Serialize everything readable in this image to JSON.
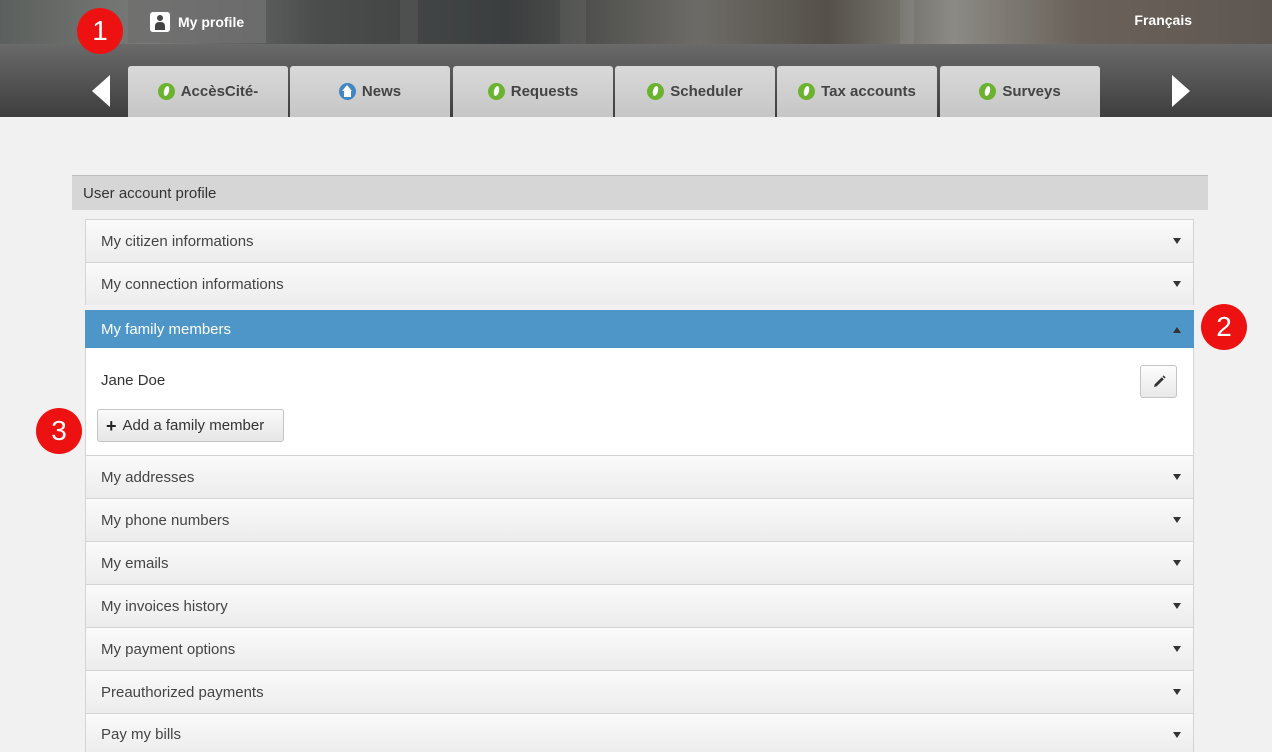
{
  "header": {
    "profile_label": "My profile",
    "language_link": "Français"
  },
  "nav": {
    "tabs": [
      {
        "label": "AccèsCité-",
        "icon": "leaf-icon"
      },
      {
        "label": "News",
        "icon": "home-icon"
      },
      {
        "label": "Requests",
        "icon": "leaf-icon"
      },
      {
        "label": "Scheduler",
        "icon": "leaf-icon"
      },
      {
        "label": "Tax accounts",
        "icon": "leaf-icon"
      },
      {
        "label": "Surveys",
        "icon": "leaf-icon"
      }
    ]
  },
  "markers": [
    "1",
    "2",
    "3"
  ],
  "profile": {
    "section_title": "User account profile",
    "items": [
      {
        "label": "My citizen informations",
        "expanded": false
      },
      {
        "label": "My connection informations",
        "expanded": false
      },
      {
        "label": "My family members",
        "expanded": true
      },
      {
        "label": "My addresses",
        "expanded": false
      },
      {
        "label": "My phone numbers",
        "expanded": false
      },
      {
        "label": "My emails",
        "expanded": false
      },
      {
        "label": "My invoices history",
        "expanded": false
      },
      {
        "label": "My payment options",
        "expanded": false
      },
      {
        "label": "Preauthorized payments",
        "expanded": false
      },
      {
        "label": "Pay my bills",
        "expanded": false
      }
    ],
    "family": {
      "members": [
        "Jane Doe"
      ],
      "add_label": "Add a family member"
    }
  },
  "colors": {
    "accent": "#4e96c8",
    "marker": "#ee1111",
    "leaf": "#6bb32e"
  }
}
